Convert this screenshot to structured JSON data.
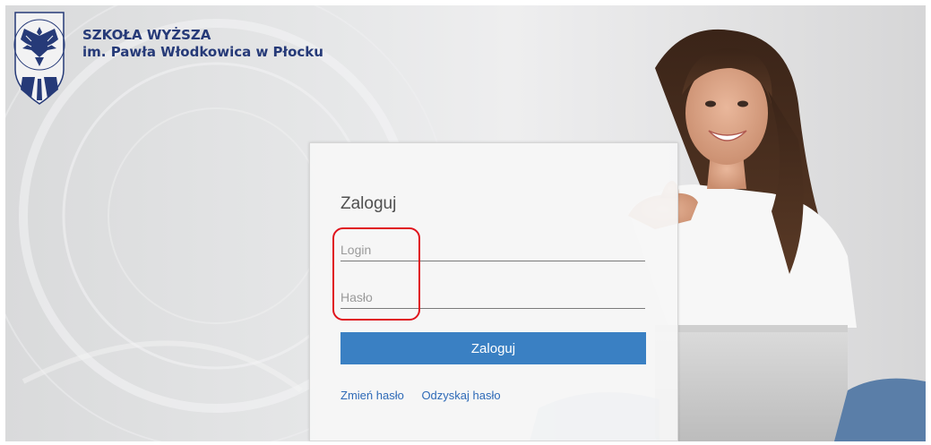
{
  "header": {
    "school_line1": "SZKOŁA WYŻSZA",
    "school_line2": "im. Pawła Włodkowica w Płocku",
    "emblem_text": "SZKOŁA WYŻSZA IM. PAWŁA WŁODKOWICA W PŁOCKU",
    "brand_color": "#263a78"
  },
  "login_form": {
    "title": "Zaloguj",
    "login_placeholder": "Login",
    "login_value": "",
    "password_placeholder": "Hasło",
    "password_value": "",
    "submit_label": "Zaloguj",
    "change_password_link": "Zmień hasło",
    "recover_password_link": "Odzyskaj hasło",
    "button_color": "#3a80c3",
    "link_color": "#2e6ab7",
    "highlight_color": "#e0131c"
  },
  "icons": {
    "emblem": "eagle-emblem-icon"
  }
}
